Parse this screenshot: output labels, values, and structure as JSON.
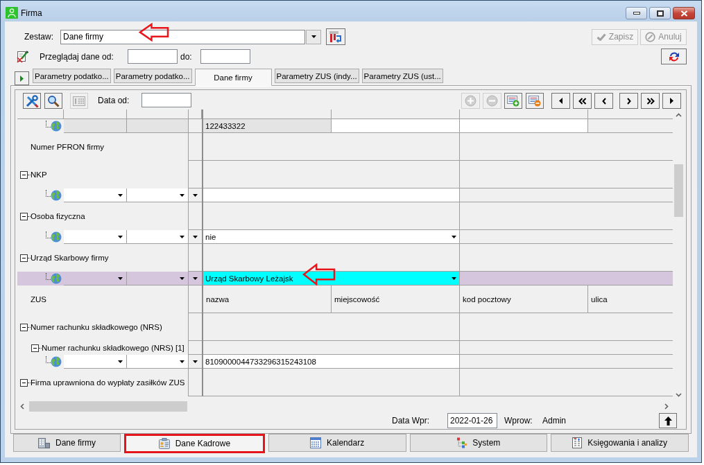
{
  "window": {
    "title": "Firma"
  },
  "zestaw": {
    "label": "Zestaw:",
    "value": "Dane firmy",
    "marked": true
  },
  "actions": [
    {
      "kind": "save",
      "label": "Zapisz",
      "disabled": true
    },
    {
      "kind": "cancel",
      "label": "Anuluj",
      "disabled": true
    }
  ],
  "browse": {
    "label": "Przeglądaj dane od:",
    "to_label": "do:"
  },
  "top_tabs": [
    {
      "label": "Parametry podatko...",
      "selected": false
    },
    {
      "label": "Parametry podatko...",
      "selected": false
    },
    {
      "label": "Dane firmy",
      "selected": true
    },
    {
      "label": "Parametry ZUS (indy...",
      "selected": false
    },
    {
      "label": "Parametry ZUS (ust...",
      "selected": false
    }
  ],
  "toolbar": {
    "date_label": "Data od:"
  },
  "tree": {
    "rows": [
      {
        "kind": "entry",
        "value": "122433322",
        "dropdown": false,
        "disabled": true,
        "selected": false
      },
      {
        "kind": "label",
        "label": "Numer PFRON firmy"
      },
      {
        "kind": "group",
        "label": "NKP",
        "expanded": true,
        "children": [
          {
            "kind": "entry",
            "dropdown": false,
            "disabled": false,
            "selected": false
          }
        ]
      },
      {
        "kind": "group",
        "label": "Osoba fizyczna",
        "expanded": true,
        "children": [
          {
            "kind": "entry",
            "value": "nie",
            "dropdown": true,
            "disabled": false,
            "selected": false
          }
        ]
      },
      {
        "kind": "group",
        "label": "Urząd Skarbowy firmy",
        "expanded": true,
        "children": [
          {
            "kind": "entry",
            "value": "Urząd Skarbowy Leżajsk",
            "dropdown": true,
            "disabled": false,
            "selected": true,
            "marked": true
          }
        ]
      },
      {
        "kind": "label",
        "label": "ZUS",
        "columns": [
          "nazwa",
          "miejscowość",
          "kod pocztowy",
          "ulica"
        ]
      },
      {
        "kind": "group",
        "label": "Numer rachunku składkowego (NRS)",
        "expanded": true,
        "children": [
          {
            "kind": "group",
            "label": "Numer rachunku składkowego (NRS) [1]",
            "expanded": true,
            "children": [
              {
                "kind": "entry",
                "value": "8109000044733296315243108",
                "dropdown": false,
                "disabled": false,
                "selected": false
              }
            ]
          }
        ]
      },
      {
        "kind": "group",
        "label": "Firma uprawniona do wypłaty zasiłków ZUS",
        "expanded": true
      }
    ]
  },
  "status": {
    "date_label": "Data Wpr:",
    "date_value": "2022-01-26",
    "author_label": "Wprow:",
    "author": "Admin"
  },
  "bottom_tabs": [
    {
      "kind": "company",
      "label": "Dane firmy",
      "selected": false
    },
    {
      "kind": "staff",
      "label": "Dane Kadrowe",
      "selected": true,
      "marked": true
    },
    {
      "kind": "calendar",
      "label": "Kalendarz",
      "selected": false
    },
    {
      "kind": "system",
      "label": "System",
      "selected": false
    },
    {
      "kind": "accounting",
      "label": "Księgowania i analizy",
      "selected": false
    }
  ]
}
